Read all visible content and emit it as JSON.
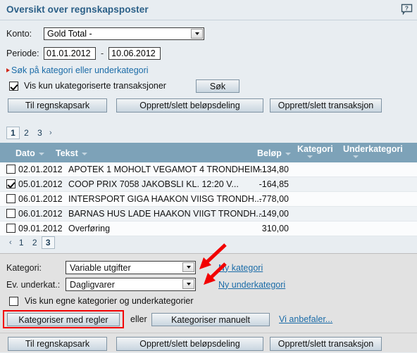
{
  "window": {
    "title": "Oversikt over regnskapsposter",
    "help_icon": "help-speech-bubble-icon"
  },
  "filters": {
    "konto_label": "Konto:",
    "konto_value": "Gold Total -",
    "periode_label": "Periode:",
    "periode_from": "01.01.2012",
    "periode_to": "10.06.2012",
    "periode_separator": "-",
    "category_search_link": "Søk på kategori eller underkategori",
    "uncategorized_checkbox_label": "Vis kun ukategoriserte transaksjoner",
    "uncategorized_checked": true,
    "search_button": "Søk"
  },
  "actionbar": {
    "to_spreadsheet": "Til regnskapsark",
    "create_delete_split": "Opprett/slett beløpsdeling",
    "create_delete_transaction": "Opprett/slett transaksjon"
  },
  "pager_top": {
    "prev": "",
    "pages": [
      "1",
      "2",
      "3"
    ],
    "current": "1",
    "next": "›"
  },
  "pager_bottom": {
    "prev": "‹",
    "pages": [
      "1",
      "2",
      "3"
    ],
    "current": "3",
    "next": ""
  },
  "table": {
    "columns": {
      "date": "Dato",
      "text": "Tekst",
      "amount": "Beløp",
      "category": "Kategori",
      "subcategory": "Underkategori"
    },
    "rows": [
      {
        "checked": false,
        "date": "02.01.2012",
        "text": "APOTEK 1 MOHOLT VEGAMOT 4 TRONDHEIM...",
        "amount": "-134,80",
        "category": "",
        "subcategory": ""
      },
      {
        "checked": true,
        "date": "05.01.2012",
        "text": "COOP PRIX 7058 JAKOBSLI KL. 12:20 V...",
        "amount": "-164,85",
        "category": "",
        "subcategory": ""
      },
      {
        "checked": false,
        "date": "06.01.2012",
        "text": "INTERSPORT GIGA HAAKON VIISG TRONDH...",
        "amount": "-778,00",
        "category": "",
        "subcategory": ""
      },
      {
        "checked": false,
        "date": "06.01.2012",
        "text": "BARNAS HUS LADE HAAKON VIIGT TRONDH...",
        "amount": "-149,00",
        "category": "",
        "subcategory": ""
      },
      {
        "checked": false,
        "date": "09.01.2012",
        "text": "Overføring",
        "amount": "310,00",
        "category": "",
        "subcategory": ""
      }
    ]
  },
  "form": {
    "category_label": "Kategori:",
    "category_value": "Variable utgifter",
    "new_category_link": "Ny kategori",
    "subcategory_label": "Ev. underkat.:",
    "subcategory_value": "Dagligvarer",
    "new_subcategory_link": "Ny underkategori",
    "own_categories_label": "Vis kun egne kategorier og underkategorier",
    "own_categories_checked": false,
    "categorize_rules_button": "Kategoriser med regler",
    "or_text": "eller",
    "categorize_manual_button": "Kategoriser manuelt",
    "recommend_link": "Vi anbefaler..."
  },
  "footerbar": {
    "to_spreadsheet": "Til regnskapsark",
    "create_delete_split": "Opprett/slett beløpsdeling",
    "create_delete_transaction": "Opprett/slett transaksjon"
  },
  "annotations": {
    "arrow_1": "red-arrow-pointing-to-category-dropdown",
    "arrow_2": "red-arrow-pointing-to-subcategory-dropdown",
    "highlight_box": "red-highlight-box-around-categorize-rules-button",
    "color": "#f20000"
  }
}
